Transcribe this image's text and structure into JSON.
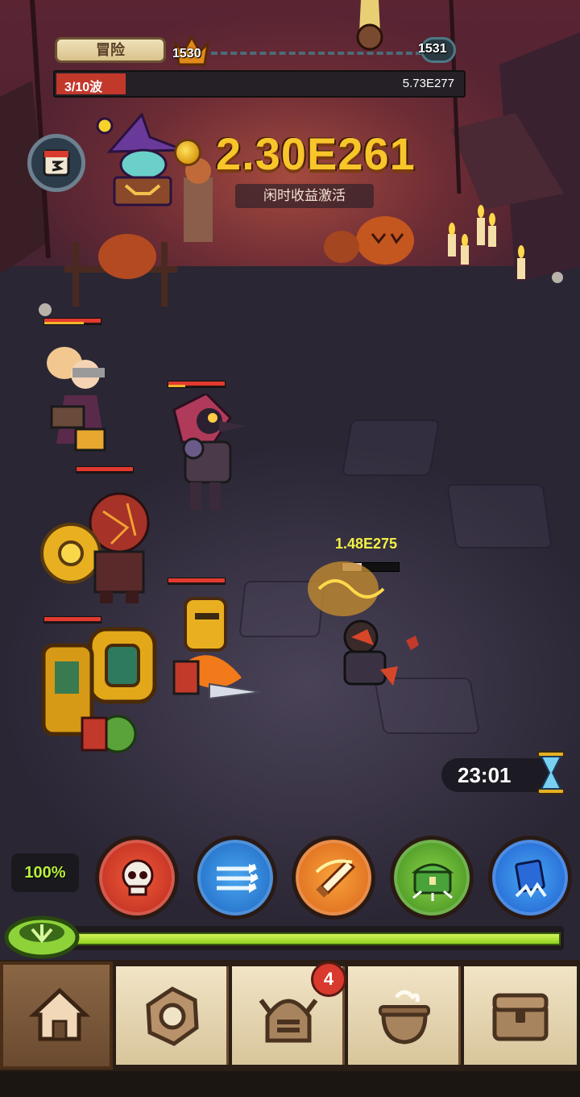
{
  "top_bar": {
    "mode_label": "冒险",
    "current_stage": "1530",
    "next_stage": "1531",
    "wave_label": "3/10波",
    "boss_hp": "5.73E277"
  },
  "currency": {
    "gold": "2.30E261",
    "idle_label": "闲时收益激活"
  },
  "battle": {
    "damage_text": "1.48E275",
    "enemy_hp_fraction": 0.34,
    "timer": "23:01"
  },
  "skills": {
    "charge_percent": "100%",
    "items": [
      {
        "icon": "skull-icon",
        "color": "#d8392a"
      },
      {
        "icon": "arrows-icon",
        "color": "#2a86df"
      },
      {
        "icon": "sword-slash-icon",
        "color": "#ef7a1e"
      },
      {
        "icon": "treasure-chest-icon",
        "color": "#5aae2a"
      },
      {
        "icon": "blue-book-icon",
        "color": "#2a7adf"
      }
    ]
  },
  "energy": {
    "fill_fraction": 1.0
  },
  "nav": {
    "items": [
      {
        "icon": "home-icon",
        "active": true
      },
      {
        "icon": "gear-nut-icon",
        "active": false
      },
      {
        "icon": "helmet-icon",
        "active": false,
        "badge": "4"
      },
      {
        "icon": "cauldron-icon",
        "active": false
      },
      {
        "icon": "chest-icon",
        "active": false
      }
    ]
  },
  "colors": {
    "gold_text": "#f8c62a",
    "wave_fill": "#c2392c",
    "energy": "#a8e23a"
  }
}
